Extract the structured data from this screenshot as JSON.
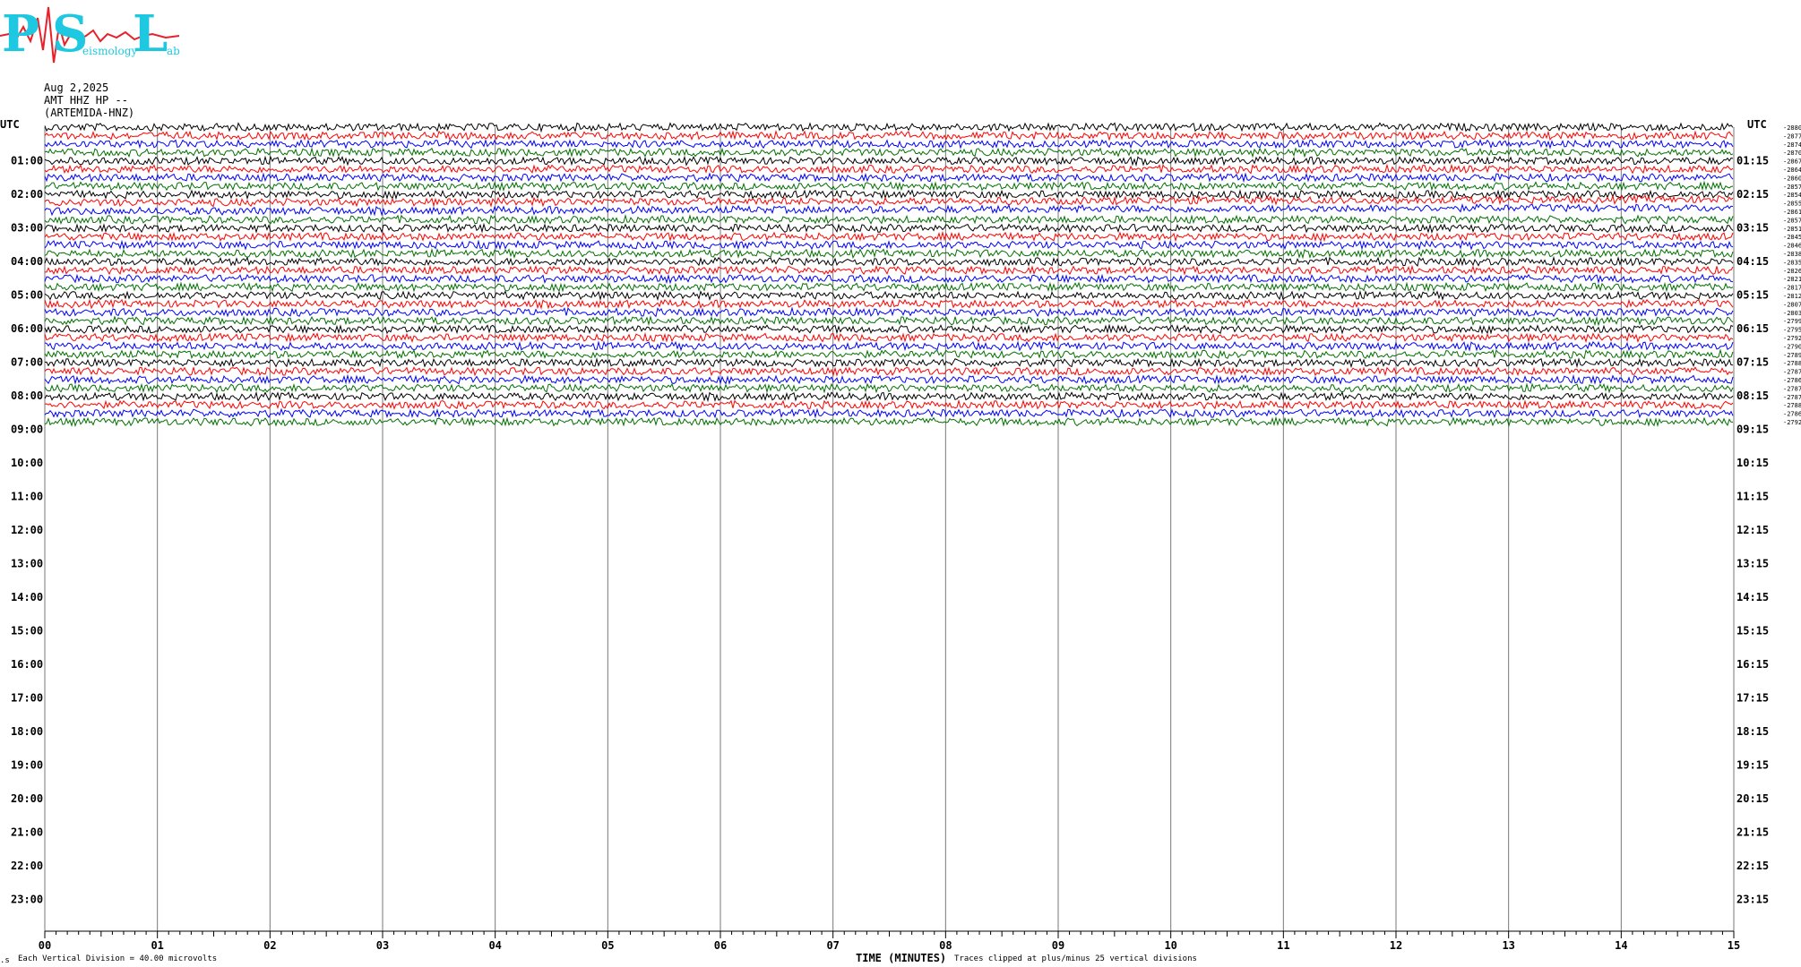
{
  "logo": {
    "letters": [
      "P",
      "S",
      "L"
    ],
    "words": [
      "",
      "eismology",
      "ab"
    ],
    "colors": {
      "text": "#1ec8e0",
      "wave": "#e8202a"
    }
  },
  "header": {
    "date": "Aug 2,2025",
    "channel": "AMT HHZ HP --",
    "station": "(ARTEMIDA-HNZ)"
  },
  "chart_data": {
    "type": "line",
    "xlabel": "TIME (MINUTES)",
    "xlim": [
      0,
      15
    ],
    "x_ticks": [
      "00",
      "01",
      "02",
      "03",
      "04",
      "05",
      "06",
      "07",
      "08",
      "09",
      "10",
      "11",
      "12",
      "13",
      "14",
      "15"
    ],
    "left_axis_label": "UTC",
    "right_axis_label": "UTC",
    "left_hour_labels": [
      "01:00",
      "02:00",
      "03:00",
      "04:00",
      "05:00",
      "06:00",
      "07:00",
      "08:00",
      "09:00",
      "10:00",
      "11:00",
      "12:00",
      "13:00",
      "14:00",
      "15:00",
      "16:00",
      "17:00",
      "18:00",
      "19:00",
      "20:00",
      "21:00",
      "22:00",
      "23:00"
    ],
    "right_hour_labels": [
      "01:15",
      "02:15",
      "03:15",
      "04:15",
      "05:15",
      "06:15",
      "07:15",
      "08:15",
      "09:15",
      "10:15",
      "11:15",
      "12:15",
      "13:15",
      "14:15",
      "15:15",
      "16:15",
      "17:15",
      "18:15",
      "19:15",
      "20:15",
      "21:15",
      "22:15",
      "23:15"
    ],
    "trace_colors": [
      "#000000",
      "#ff0000",
      "#0000ff",
      "#007000"
    ],
    "trace_count": 36,
    "trace_offsets": [
      "-28808",
      "-28773",
      "-28741",
      "-28704",
      "-28674",
      "-28640",
      "-28607",
      "-28576",
      "-28548",
      "-28559",
      "-28619",
      "-28570",
      "-28516",
      "-28457",
      "-28465",
      "-28386",
      "-28353",
      "-28261",
      "-28217",
      "-28178",
      "-28121",
      "-28071",
      "-28038",
      "-27996",
      "-27958",
      "-27927",
      "-27907",
      "-27898",
      "-27882",
      "-27873",
      "-27868",
      "-27878",
      "-27874",
      "-27884",
      "-27863",
      "-27923"
    ]
  },
  "footer": {
    "left_note": "Each Vertical Division =   40.00 microvolts",
    "right_note": "Traces clipped at plus/minus 25 vertical divisions",
    "corner_mark": ".s"
  }
}
